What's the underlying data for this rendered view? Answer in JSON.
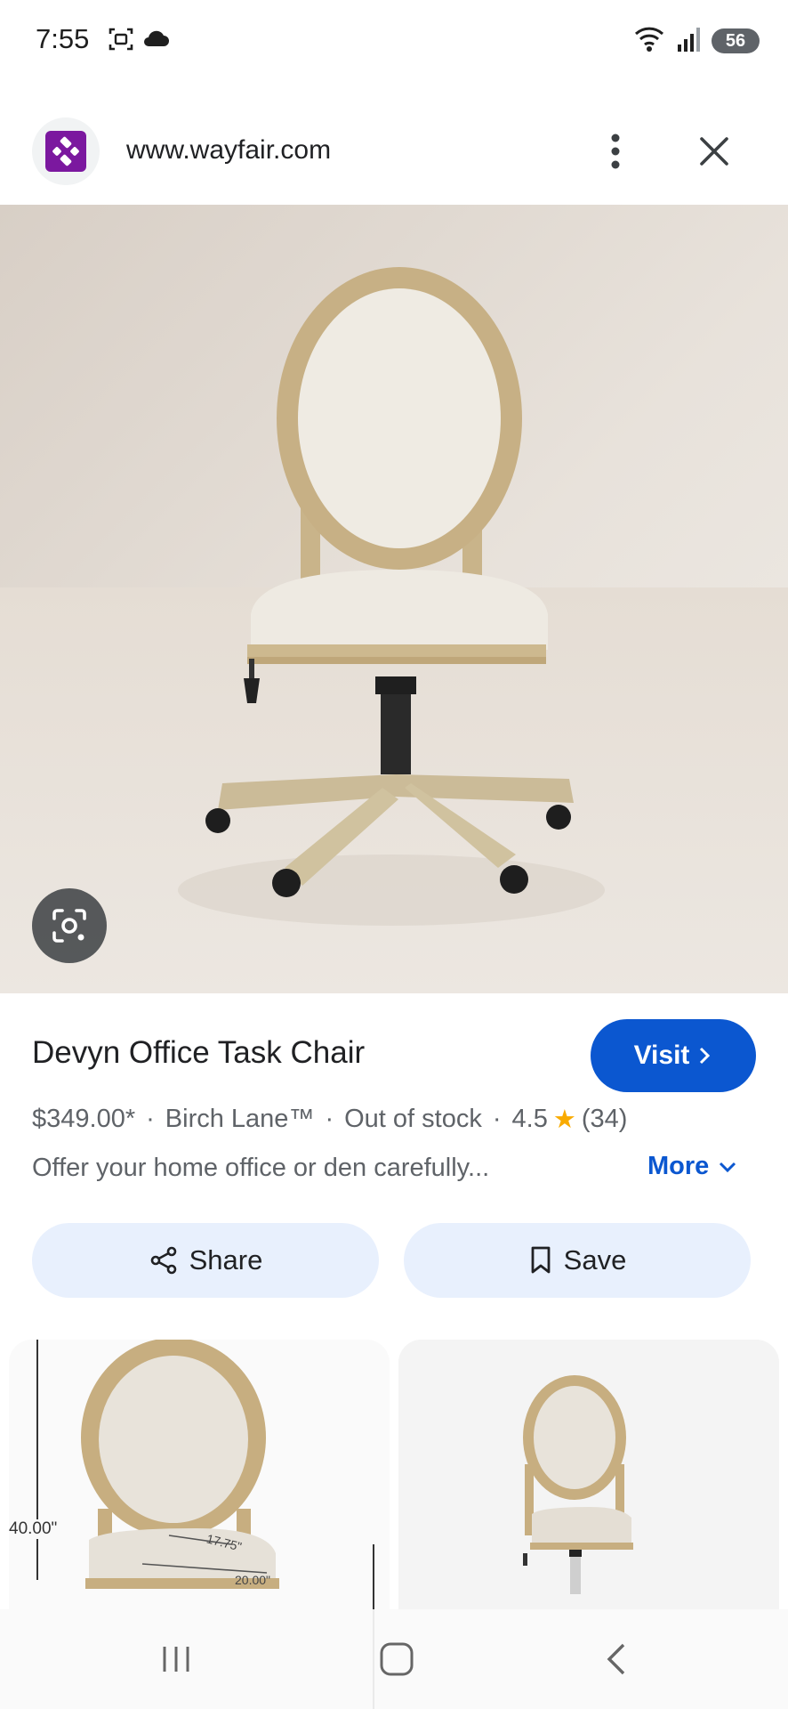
{
  "status_bar": {
    "time": "7:55",
    "battery": "56",
    "icons": [
      "screenshot-icon",
      "cloud-icon",
      "wifi-icon",
      "signal-icon",
      "battery-icon"
    ]
  },
  "browser": {
    "url": "www.wayfair.com",
    "favicon": "wayfair-icon",
    "brand_color": "#7b189f"
  },
  "product": {
    "title": "Devyn Office Task Chair",
    "visit_label": "Visit",
    "price": "$349.00*",
    "brand": "Birch Lane™",
    "stock": "Out of stock",
    "rating": "4.5",
    "review_count": "(34)",
    "description": "Offer your home office or den carefully...",
    "more_label": "More",
    "accent_color": "#0b57d0"
  },
  "actions": {
    "share_label": "Share",
    "save_label": "Save"
  },
  "thumbnails": [
    {
      "dim_height": "40.00\"",
      "dim_depth": "17.75\"",
      "dim_width": "20.00\""
    },
    {}
  ],
  "nav": {
    "icons": [
      "recent-apps-icon",
      "home-icon",
      "back-icon"
    ]
  }
}
